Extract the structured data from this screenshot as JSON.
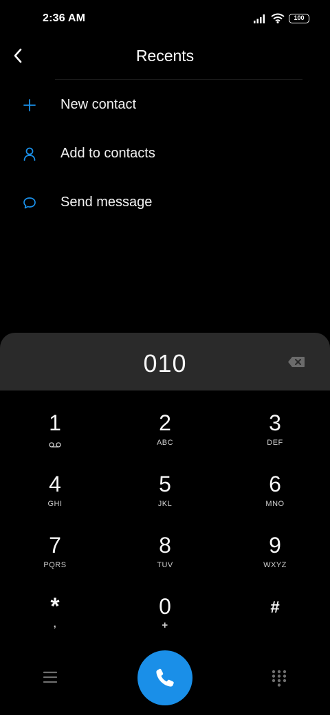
{
  "status_bar": {
    "time": "2:36 AM",
    "battery": "100",
    "icons": [
      "signal-icon",
      "wifi-icon",
      "battery-icon"
    ]
  },
  "header": {
    "title": "Recents",
    "back_icon": "chevron-left-icon"
  },
  "actions": [
    {
      "label": "New contact",
      "icon": "plus-icon"
    },
    {
      "label": "Add to contacts",
      "icon": "person-icon"
    },
    {
      "label": "Send message",
      "icon": "message-bubble-icon"
    }
  ],
  "dialer": {
    "number": "010",
    "backspace_icon": "backspace-icon"
  },
  "keypad": {
    "keys": [
      {
        "digit": "1",
        "letters": ""
      },
      {
        "digit": "2",
        "letters": "ABC"
      },
      {
        "digit": "3",
        "letters": "DEF"
      },
      {
        "digit": "4",
        "letters": "GHI"
      },
      {
        "digit": "5",
        "letters": "JKL"
      },
      {
        "digit": "6",
        "letters": "MNO"
      },
      {
        "digit": "7",
        "letters": "PQRS"
      },
      {
        "digit": "8",
        "letters": "TUV"
      },
      {
        "digit": "9",
        "letters": "WXYZ"
      },
      {
        "digit": "*",
        "letters": ","
      },
      {
        "digit": "0",
        "letters": "+"
      },
      {
        "digit": "#",
        "letters": ""
      }
    ]
  },
  "bottom_bar": {
    "menu_icon": "hamburger-menu-icon",
    "call_icon": "phone-icon",
    "dialpad_icon": "dialpad-icon"
  },
  "colors": {
    "accent": "#1a8fe8",
    "background": "#000000",
    "display_panel": "#2a2a2a"
  }
}
